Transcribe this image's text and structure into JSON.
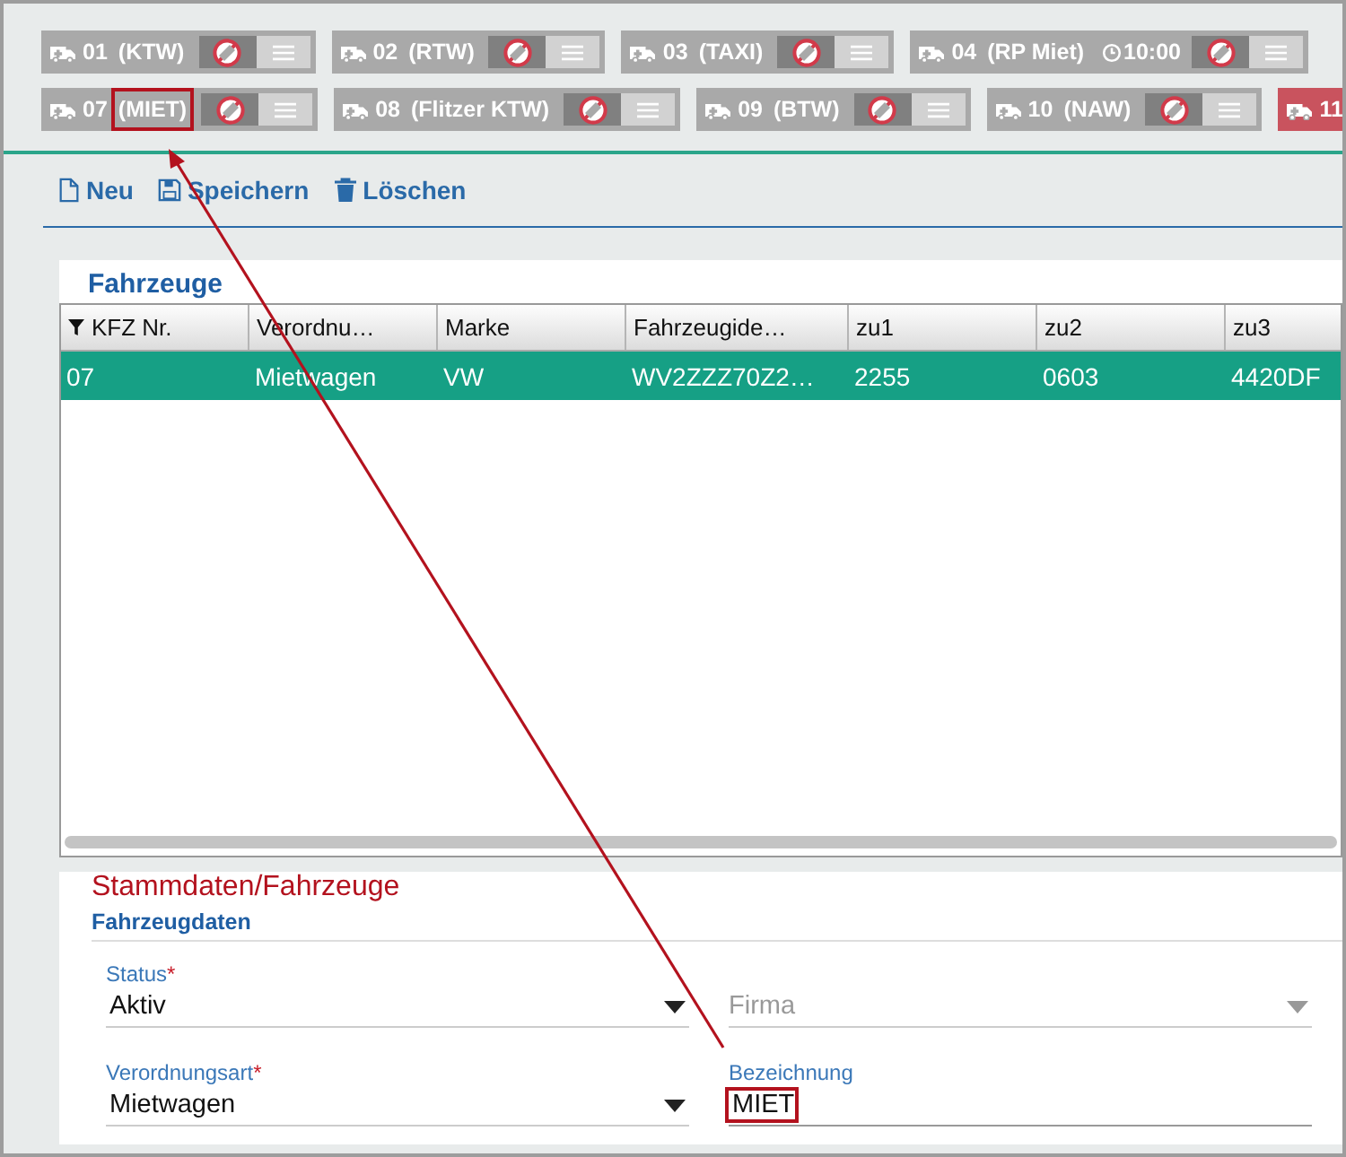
{
  "vehicle_tabs": [
    [
      {
        "number": "01",
        "type": "(KTW)",
        "color": "#a9a9a9",
        "highlighted": false
      },
      {
        "number": "02",
        "type": "(RTW)",
        "color": "#a9a9a9",
        "highlighted": false
      },
      {
        "number": "03",
        "type": "(TAXI)",
        "color": "#a9a9a9",
        "highlighted": false
      },
      {
        "number": "04",
        "type": "(RP Miet)",
        "time": "10:00",
        "color": "#a9a9a9",
        "highlighted": false
      }
    ],
    [
      {
        "number": "07",
        "type": "(MIET)",
        "color": "#a9a9a9",
        "highlighted": true
      },
      {
        "number": "08",
        "type": "(Flitzer KTW)",
        "color": "#a9a9a9",
        "highlighted": false
      },
      {
        "number": "09",
        "type": "(BTW)",
        "color": "#a9a9a9",
        "highlighted": false
      },
      {
        "number": "10",
        "type": "(NAW)",
        "color": "#a9a9a9",
        "highlighted": false
      },
      {
        "number": "11",
        "color": "#c9535e"
      }
    ]
  ],
  "toolbar": [
    {
      "kind": "new",
      "label": "Neu"
    },
    {
      "kind": "save",
      "label": "Speichern"
    },
    {
      "kind": "delete",
      "label": "Löschen"
    }
  ],
  "table": {
    "title": "Fahrzeuge",
    "columns": [
      {
        "label": "KFZ Nr.",
        "filtered": true
      },
      {
        "label": "Verordnu…",
        "filtered": false
      },
      {
        "label": "Marke",
        "filtered": false
      },
      {
        "label": "Fahrzeugide…",
        "filtered": false
      },
      {
        "label": "zu1",
        "filtered": false
      },
      {
        "label": "zu2",
        "filtered": false
      },
      {
        "label": "zu3",
        "filtered": false
      }
    ],
    "rows": [
      {
        "selected": true,
        "cells": [
          "07",
          "Mietwagen",
          "VW",
          "WV2ZZZ70Z2…",
          "2255",
          "0603",
          "4420DF"
        ]
      }
    ]
  },
  "annotation": {
    "caption": "Stammdaten/Fahrzeuge"
  },
  "form": {
    "section": "Fahrzeugdaten",
    "fields": [
      {
        "kind": "select",
        "label": "Status",
        "required_mark": "*",
        "value": "Aktiv",
        "disabled": false,
        "highlighted": false
      },
      {
        "kind": "select",
        "placeholder": "Firma",
        "disabled": true,
        "highlighted": false
      },
      {
        "kind": "select",
        "label": "Verordnungsart",
        "required_mark": "*",
        "value": "Mietwagen",
        "disabled": false,
        "highlighted": false
      },
      {
        "kind": "text",
        "label": "Bezeichnung",
        "value": "MIET",
        "disabled": false,
        "highlighted": true
      }
    ]
  }
}
